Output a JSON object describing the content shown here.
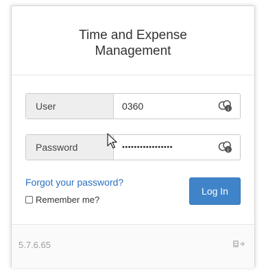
{
  "header": {
    "title": "Time and Expense Management"
  },
  "user_field": {
    "label": "User",
    "value": "0360",
    "icon": "key-manager-icon"
  },
  "password_field": {
    "label": "Password",
    "value": "•••••••••••••••••",
    "icon": "key-manager-icon"
  },
  "forgot_link": "Forgot your password?",
  "remember": {
    "label": "Remember me?",
    "checked": false
  },
  "login_button": "Log In",
  "footer": {
    "version": "5.7.6.65",
    "icon": "language-switch-icon"
  },
  "colors": {
    "accent": "#3f84c9",
    "link": "#2a6fc1"
  }
}
